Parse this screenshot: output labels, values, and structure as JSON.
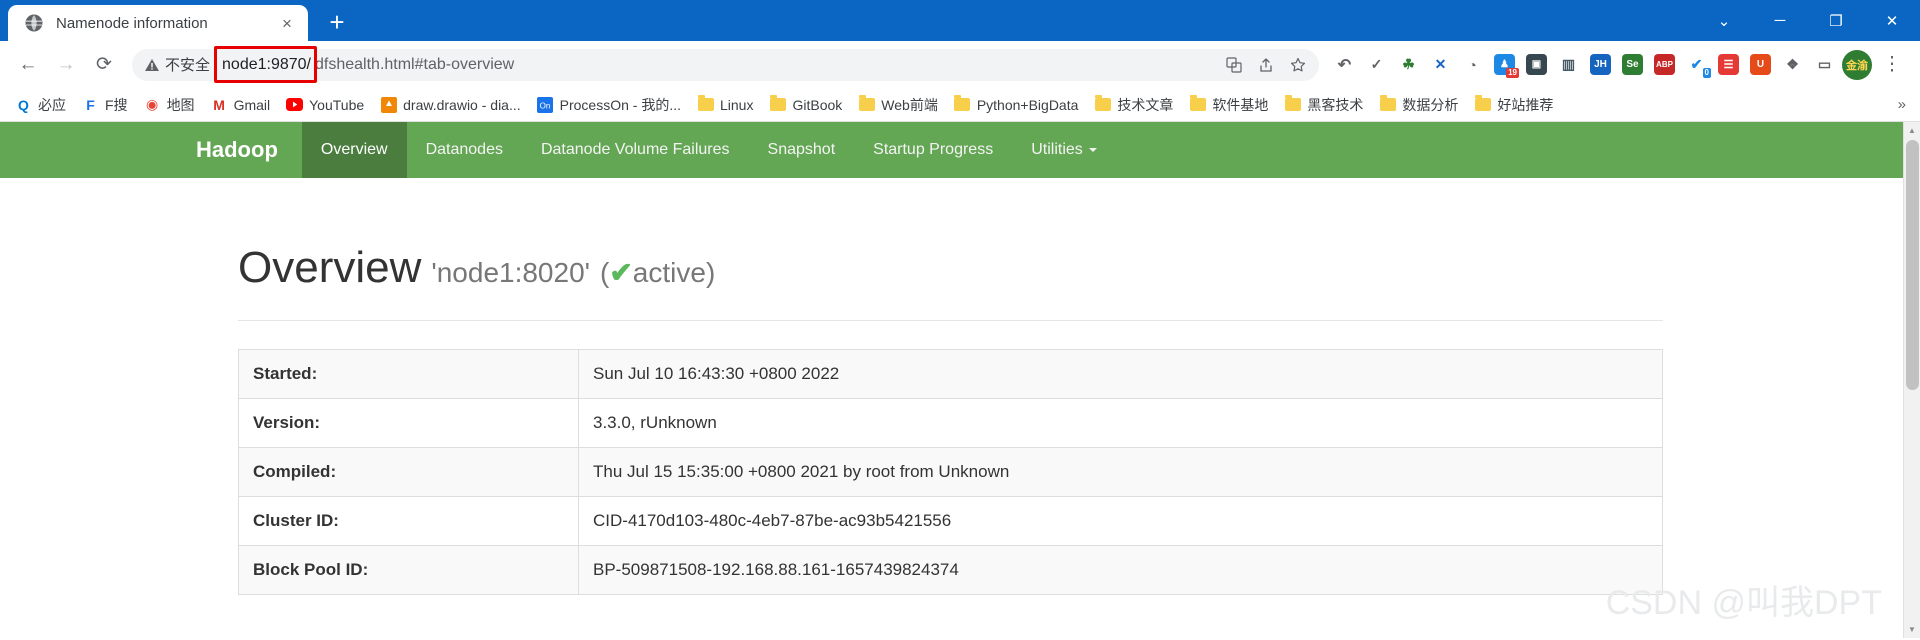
{
  "browser": {
    "tab": {
      "title": "Namenode information",
      "favicon": "globe-icon",
      "close": "×"
    },
    "new_tab_label": "+",
    "window_controls": {
      "minimize_all": "⌄",
      "minimize": "─",
      "maximize": "❐",
      "close": "✕"
    },
    "nav": {
      "back": "←",
      "forward": "→",
      "reload": "⟳"
    },
    "omnibox": {
      "warning_icon": "warning-triangle-icon",
      "security_label": "不安全",
      "url_host": "node1:9870/",
      "url_path": "dfshealth.html#tab-overview",
      "full_url": "node1:9870/dfshealth.html#tab-overview",
      "highlight_color": "#e60000"
    },
    "omni_icons": [
      "translate-icon",
      "share-icon",
      "star-icon"
    ],
    "extensions": [
      {
        "name": "undo-icon",
        "glyph": "↶",
        "color": "#5f6368",
        "text_color": "#5f6368",
        "badge": ""
      },
      {
        "name": "check-icon",
        "glyph": "✓",
        "color": "#5f6368",
        "text_color": "#5f6368",
        "badge": ""
      },
      {
        "name": "leaf-icon",
        "glyph": "☘",
        "color": "#2e7d32",
        "text_color": "#2e7d32",
        "badge": ""
      },
      {
        "name": "x-blue-icon",
        "glyph": "✕",
        "color": "#1565c0",
        "text_color": "#1565c0",
        "badge": ""
      },
      {
        "name": "clock-icon",
        "glyph": "◴",
        "color": "#5f6368",
        "text_color": "#5f6368",
        "badge": ""
      },
      {
        "name": "people-icon",
        "glyph": "♟",
        "color": "#1e88e5",
        "text_color": "#1e88e5",
        "badge": "19"
      },
      {
        "name": "window-icon",
        "glyph": "▣",
        "color": "#37474f",
        "text_color": "#37474f",
        "badge": ""
      },
      {
        "name": "split-icon",
        "glyph": "◫",
        "color": "#455a64",
        "text_color": "#455a64",
        "badge": ""
      },
      {
        "name": "jh-icon",
        "glyph": "JH",
        "color": "#1565c0",
        "text_color": "#ffffff",
        "badge": ""
      },
      {
        "name": "se-icon",
        "glyph": "Se",
        "color": "#2e7d32",
        "text_color": "#ffffff",
        "badge": ""
      },
      {
        "name": "abp-icon",
        "glyph": "ABP",
        "color": "#c62828",
        "text_color": "#ffffff",
        "badge": ""
      },
      {
        "name": "check-circle-icon",
        "glyph": "✔",
        "color": "#1e88e5",
        "text_color": "#1e88e5",
        "badge": "0"
      },
      {
        "name": "note-icon",
        "glyph": "☰",
        "color": "#e53935",
        "text_color": "#ffffff",
        "badge": ""
      },
      {
        "name": "u-icon",
        "glyph": "U",
        "color": "#e64a19",
        "text_color": "#ffffff",
        "badge": ""
      },
      {
        "name": "puzzle-icon",
        "glyph": "❖",
        "color": "#5f6368",
        "text_color": "#5f6368",
        "badge": ""
      },
      {
        "name": "sidepanel-icon",
        "glyph": "▭",
        "color": "#5f6368",
        "text_color": "#5f6368",
        "badge": ""
      }
    ],
    "profile": {
      "name": "profile-avatar",
      "label": "金渝"
    },
    "menu_icon": "⋮",
    "bookmarks": [
      {
        "label": "必应",
        "icon": "bing-icon",
        "type": "site",
        "color": "#0078d4",
        "glyph": "Q"
      },
      {
        "label": "F搜",
        "icon": "f-search-icon",
        "type": "site",
        "color": "#1a73e8",
        "glyph": "F"
      },
      {
        "label": "地图",
        "icon": "maps-icon",
        "type": "site",
        "color": "#ea4335",
        "glyph": "◉"
      },
      {
        "label": "Gmail",
        "icon": "gmail-icon",
        "type": "site",
        "color": "#d93025",
        "glyph": "M"
      },
      {
        "label": "YouTube",
        "icon": "youtube-icon",
        "type": "site",
        "color": "#ff0000",
        "glyph": "▶"
      },
      {
        "label": "draw.drawio - dia...",
        "icon": "drawio-icon",
        "type": "site",
        "color": "#f08705",
        "glyph": "✦"
      },
      {
        "label": "ProcessOn - 我的...",
        "icon": "processon-icon",
        "type": "site",
        "color": "#1a73e8",
        "glyph": "On"
      },
      {
        "label": "Linux",
        "icon": "folder-icon",
        "type": "folder"
      },
      {
        "label": "GitBook",
        "icon": "folder-icon",
        "type": "folder"
      },
      {
        "label": "Web前端",
        "icon": "folder-icon",
        "type": "folder"
      },
      {
        "label": "Python+BigData",
        "icon": "folder-icon",
        "type": "folder"
      },
      {
        "label": "技术文章",
        "icon": "folder-icon",
        "type": "folder"
      },
      {
        "label": "软件基地",
        "icon": "folder-icon",
        "type": "folder"
      },
      {
        "label": "黑客技术",
        "icon": "folder-icon",
        "type": "folder"
      },
      {
        "label": "数据分析",
        "icon": "folder-icon",
        "type": "folder"
      },
      {
        "label": "好站推荐",
        "icon": "folder-icon",
        "type": "folder"
      }
    ],
    "bookmarks_overflow": "»"
  },
  "hadoop": {
    "brand": "Hadoop",
    "nav_items": [
      {
        "label": "Overview",
        "active": true,
        "dropdown": false
      },
      {
        "label": "Datanodes",
        "active": false,
        "dropdown": false
      },
      {
        "label": "Datanode Volume Failures",
        "active": false,
        "dropdown": false
      },
      {
        "label": "Snapshot",
        "active": false,
        "dropdown": false
      },
      {
        "label": "Startup Progress",
        "active": false,
        "dropdown": false
      },
      {
        "label": "Utilities",
        "active": false,
        "dropdown": true
      }
    ],
    "nav_bg": "#63a653",
    "nav_active_bg": "#4a7d3e",
    "overview": {
      "title": "Overview",
      "address": "'node1:8020'",
      "status_open": "(",
      "status_check": "✔",
      "status_text": "active",
      "status_close": ")",
      "status_color": "#5cb85c"
    },
    "info_rows": [
      {
        "key": "Started:",
        "value": "Sun Jul 10 16:43:30 +0800 2022"
      },
      {
        "key": "Version:",
        "value": "3.3.0, rUnknown"
      },
      {
        "key": "Compiled:",
        "value": "Thu Jul 15 15:35:00 +0800 2021 by root from Unknown"
      },
      {
        "key": "Cluster ID:",
        "value": "CID-4170d103-480c-4eb7-87be-ac93b5421556"
      },
      {
        "key": "Block Pool ID:",
        "value": "BP-509871508-192.168.88.161-1657439824374"
      }
    ]
  },
  "watermark": "CSDN @叫我DPT"
}
